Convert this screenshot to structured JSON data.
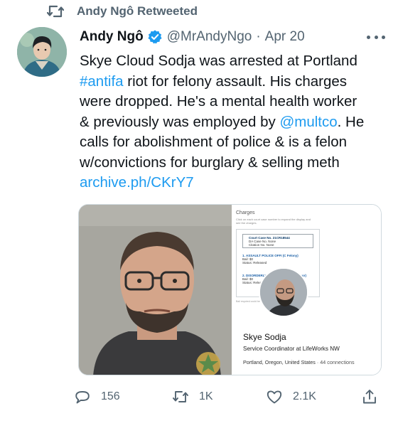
{
  "retweet": {
    "label": "Andy Ngô Retweeted",
    "icon": "retweet-icon"
  },
  "tweet": {
    "author_name": "Andy Ngô",
    "verified": true,
    "handle": "@MrAndyNgo",
    "separator": "·",
    "date": "Apr 20",
    "more_icon": "more-dots-icon",
    "lines": [
      {
        "text": "Skye Cloud Sodja was arrested at Portland"
      },
      {
        "link": "#antifa",
        "text": " riot for felony assault. His charges"
      },
      {
        "text": "were dropped. He's a mental health worker"
      },
      {
        "pre": "& previously was employed by ",
        "link": "@multco",
        "post": ". He"
      },
      {
        "text": "calls for abolishment of police & is a felon"
      },
      {
        "text": "w/convictions for burglary & selling meth"
      },
      {
        "link": "archive.ph/CKrY7"
      }
    ]
  },
  "media": {
    "charges": {
      "title": "Charges",
      "note": "Click on each court case number to expand the display and see the charges.",
      "case_label": "Court Case No.",
      "case_number": "21CR18544",
      "da_case": "DA Case No. None",
      "citation": "Citation No. None",
      "charges": [
        {
          "num": "1.",
          "name": "ASSAULT POLICE OFFI (C Felony)",
          "bail": "Bail: $0",
          "status": "Status: Released"
        },
        {
          "num": "2.",
          "name": "DISORDERLY COND 2 (B Misdemeanor)",
          "bail": "Bail: $0",
          "status": "Status: Released"
        }
      ],
      "footnote": "Bail required could be 10 percent or 100% of the full amount."
    },
    "profile": {
      "name": "Skye Sodja",
      "title": "Service Coordinator at LifeWorks NW",
      "location": "Portland, Oregon, United States",
      "separator": "·",
      "connections": "44 connections"
    }
  },
  "actions": {
    "reply": {
      "icon": "reply-icon",
      "count": "156"
    },
    "retweet": {
      "icon": "retweet-icon",
      "count": "1K"
    },
    "like": {
      "icon": "heart-icon",
      "count": "2.1K"
    },
    "share": {
      "icon": "share-icon"
    }
  },
  "colors": {
    "link": "#1d9bf0",
    "muted": "#536471",
    "text": "#0f1419",
    "verified": "#1d9bf0"
  }
}
